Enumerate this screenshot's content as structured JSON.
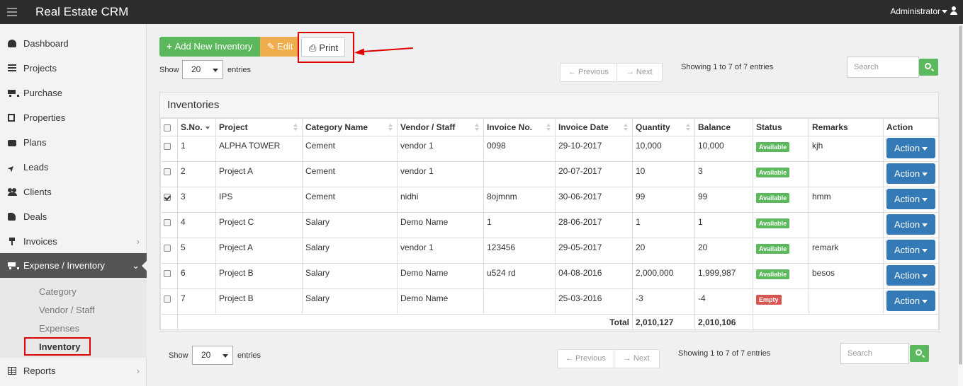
{
  "app": {
    "title": "Real Estate CRM",
    "user": "Administrator"
  },
  "sidebar": {
    "items": [
      {
        "label": "Dashboard"
      },
      {
        "label": "Projects"
      },
      {
        "label": "Purchase"
      },
      {
        "label": "Properties"
      },
      {
        "label": "Plans"
      },
      {
        "label": "Leads"
      },
      {
        "label": "Clients"
      },
      {
        "label": "Deals"
      },
      {
        "label": "Invoices"
      },
      {
        "label": "Expense / Inventory"
      },
      {
        "label": "Reports"
      }
    ],
    "chevron_right": "›",
    "chevron_down": "⌄",
    "submenu": [
      {
        "label": "Category"
      },
      {
        "label": "Vendor / Staff"
      },
      {
        "label": "Expenses"
      },
      {
        "label": "Inventory"
      }
    ]
  },
  "toolbar": {
    "add_label": "Add New Inventory",
    "add_icon": "+",
    "edit_label": "Edit",
    "edit_icon": "✎",
    "print_label": "Print",
    "print_icon": "⎙"
  },
  "controls": {
    "show_label": "Show",
    "entries_label": "entries",
    "page_size": "20",
    "prev_label": "← Previous",
    "next_label": "→ Next",
    "showing_text": "Showing 1 to 7 of 7 entries",
    "search_placeholder": "Search"
  },
  "panel": {
    "title": "Inventories"
  },
  "table": {
    "headers": [
      "S.No.",
      "Project",
      "Category Name",
      "Vendor / Staff",
      "Invoice No.",
      "Invoice Date",
      "Quantity",
      "Balance",
      "Status",
      "Remarks",
      "Action"
    ],
    "rows": [
      {
        "sno": "1",
        "project": "ALPHA TOWER",
        "category": "Cement",
        "vendor": "vendor 1",
        "invoice": "0098",
        "date": "29-10-2017",
        "quantity": "10,000",
        "balance": "10,000",
        "status": "Available",
        "remarks": "kjh",
        "checked": false
      },
      {
        "sno": "2",
        "project": "Project A",
        "category": "Cement",
        "vendor": "vendor 1",
        "invoice": "",
        "date": "20-07-2017",
        "quantity": "10",
        "balance": "3",
        "status": "Available",
        "remarks": "",
        "checked": false
      },
      {
        "sno": "3",
        "project": "IPS",
        "category": "Cement",
        "vendor": "nidhi",
        "invoice": "8ojmnm",
        "date": "30-06-2017",
        "quantity": "99",
        "balance": "99",
        "status": "Available",
        "remarks": "hmm",
        "checked": true
      },
      {
        "sno": "4",
        "project": "Project C",
        "category": "Salary",
        "vendor": "Demo Name",
        "invoice": "1",
        "date": "28-06-2017",
        "quantity": "1",
        "balance": "1",
        "status": "Available",
        "remarks": "",
        "checked": false
      },
      {
        "sno": "5",
        "project": "Project A",
        "category": "Salary",
        "vendor": "vendor 1",
        "invoice": "123456",
        "date": "29-05-2017",
        "quantity": "20",
        "balance": "20",
        "status": "Available",
        "remarks": "remark",
        "checked": false
      },
      {
        "sno": "6",
        "project": "Project B",
        "category": "Salary",
        "vendor": "Demo Name",
        "invoice": "u524 rd",
        "date": "04-08-2016",
        "quantity": "2,000,000",
        "balance": "1,999,987",
        "status": "Available",
        "remarks": "besos",
        "checked": false
      },
      {
        "sno": "7",
        "project": "Project B",
        "category": "Salary",
        "vendor": "Demo Name",
        "invoice": "",
        "date": "25-03-2016",
        "quantity": "-3",
        "balance": "-4",
        "status": "Empty",
        "remarks": "",
        "checked": false
      }
    ],
    "action_label": "Action",
    "total_label": "Total",
    "total_quantity": "2,010,127",
    "total_balance": "2,010,106"
  },
  "colors": {
    "topbar": "#2d2d2d",
    "success": "#5cb85c",
    "warning": "#f0ad4e",
    "primary": "#337ab7",
    "danger": "#d9534f",
    "highlight": "#e00000"
  }
}
